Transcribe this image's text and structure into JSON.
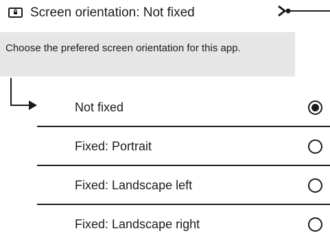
{
  "header": {
    "icon": "screen-lock-icon",
    "title": "Screen orientation: Not fixed"
  },
  "help": {
    "text": "Choose the prefered screen orientation for this app."
  },
  "options": [
    {
      "label": "Not fixed",
      "selected": true
    },
    {
      "label": "Fixed: Portrait",
      "selected": false
    },
    {
      "label": "Fixed: Landscape left",
      "selected": false
    },
    {
      "label": "Fixed: Landscape right",
      "selected": false
    }
  ],
  "colors": {
    "text": "#1a1a1a",
    "help_background": "#e6e6e6",
    "background": "#ffffff"
  }
}
